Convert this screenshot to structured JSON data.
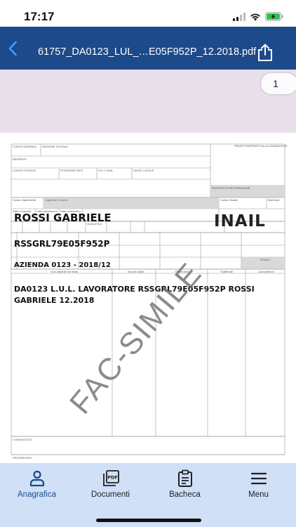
{
  "status_bar": {
    "time": "17:17"
  },
  "nav": {
    "title": "61757_DA0123_LUL_…E05F952P_12.2018.pdf"
  },
  "viewer": {
    "page_indicator": "1"
  },
  "document": {
    "employee_name": "ROSSI GABRIELE",
    "fiscal_code": "RSSGRL79E05F952P",
    "company_period": "AZIENDA 0123 - 2018/12",
    "description_line1": "DA0123 L.U.L. LAVORATORE RSSGRL79E05F952P ROSSI",
    "description_line2": "GABRIELE 12.2018",
    "watermark": "FAC-SIMILE",
    "logo": "INAIL",
    "form_labels": {
      "codice_azienda": "CODICE AZIENDA",
      "ragione_sociale": "RAGIONE SOCIALE",
      "spazio_riservato": "SPAZIO RISERVATO ALLA VIDIMAZIONE",
      "indirizzo": "INDIRIZZO",
      "codice_fiscale": "CODICE FISCALE",
      "posizione_inps": "POSIZIONE INPS",
      "pat_inail": "P.A.T. INAIL",
      "unita_locale": "UNITA' LOCALE",
      "periodo_retribuzione": "PERIODO DI RETRIBUZIONE",
      "codice_dipendente": "Codice dipendente",
      "cognome_nome": "Cognome e nome",
      "codice_fiscale_dip": "Codice fiscale",
      "matricola": "Matricola",
      "data_nascita": "Data di nascita",
      "data_assunzione": "Data assunzione",
      "data_cessazione": "Data cessazione",
      "qualifica": "QUALIFICA",
      "voci_variabili": "Voci variabili del mese",
      "importo_base": "Importo base",
      "riferimento": "Riferimento",
      "trattenute": "Trattenute",
      "competenze": "Competenze",
      "totale": "TOTALE",
      "conguaglio": "CONGUAGLIO",
      "progressivi": "PROGRESSIVI"
    }
  },
  "tabs": [
    {
      "label": "Anagrafica",
      "icon": "person-icon",
      "active": true
    },
    {
      "label": "Documenti",
      "icon": "pdf-document-icon",
      "active": false
    },
    {
      "label": "Bacheca",
      "icon": "clipboard-icon",
      "active": false
    },
    {
      "label": "Menu",
      "icon": "hamburger-menu-icon",
      "active": false
    }
  ],
  "colors": {
    "nav_background": "#1c4a8a",
    "viewer_background": "#e8e1ec",
    "tab_bar_background": "#cfe0f7",
    "active_tab": "#1c4a8a",
    "battery": "#30c24a"
  }
}
